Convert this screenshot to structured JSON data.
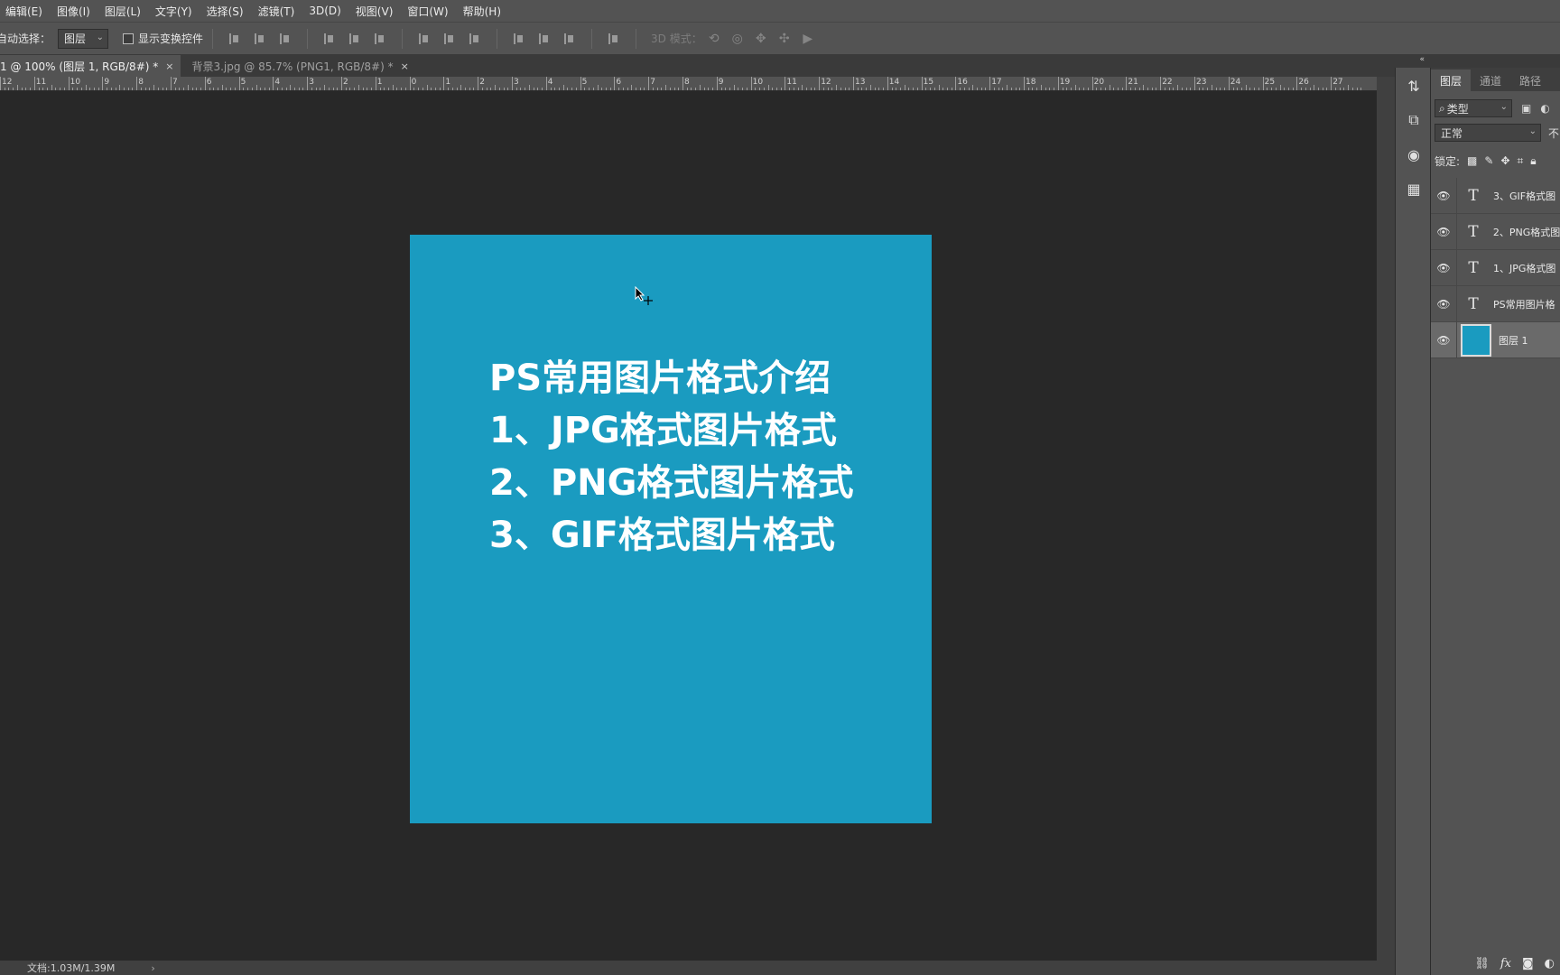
{
  "menu": [
    "编辑(E)",
    "图像(I)",
    "图层(L)",
    "文字(Y)",
    "选择(S)",
    "滤镜(T)",
    "3D(D)",
    "视图(V)",
    "窗口(W)",
    "帮助(H)"
  ],
  "options": {
    "auto_select_label": "自动选择：",
    "auto_select_value": "图层",
    "show_transform_label": "显示变换控件",
    "mode_3d_label": "3D 模式："
  },
  "tabs": [
    {
      "label": "1 @ 100% (图层 1, RGB/8#) *",
      "close": "×",
      "active": true
    },
    {
      "label": "背景3.jpg @ 85.7% (PNG1, RGB/8#) *",
      "close": "×",
      "active": false
    }
  ],
  "ruler": {
    "labels": [
      "12",
      "11",
      "10",
      "9",
      "8",
      "7",
      "6",
      "5",
      "4",
      "3",
      "2",
      "1",
      "0",
      "1",
      "2",
      "3",
      "4",
      "5",
      "6",
      "7",
      "8",
      "9",
      "10",
      "11",
      "12",
      "13",
      "14",
      "15",
      "16",
      "17",
      "18",
      "19",
      "20",
      "21",
      "22",
      "23",
      "24",
      "25",
      "26",
      "27"
    ]
  },
  "document": {
    "background_color": "#1a9bc0",
    "lines": [
      "PS常用图片格式介绍",
      "1、JPG格式图片格式",
      "2、PNG格式图片格式",
      "3、GIF格式图片格式"
    ]
  },
  "status": {
    "doc_size": "文档:1.03M/1.39M",
    "arrow": "›"
  },
  "panel": {
    "tabs": [
      "图层",
      "通道",
      "路径"
    ],
    "filter_value": "类型",
    "blend_value": "正常",
    "opacity_label": "不",
    "lock_label": "锁定:",
    "layers": [
      {
        "name": "3、GIF格式图",
        "kind": "text",
        "visible": true,
        "selected": false
      },
      {
        "name": "2、PNG格式图",
        "kind": "text",
        "visible": true,
        "selected": false
      },
      {
        "name": "1、JPG格式图",
        "kind": "text",
        "visible": true,
        "selected": false
      },
      {
        "name": "PS常用图片格",
        "kind": "text",
        "visible": true,
        "selected": false
      },
      {
        "name": "图层 1",
        "kind": "fill",
        "visible": true,
        "selected": true
      }
    ],
    "footer_fx": "fx"
  }
}
